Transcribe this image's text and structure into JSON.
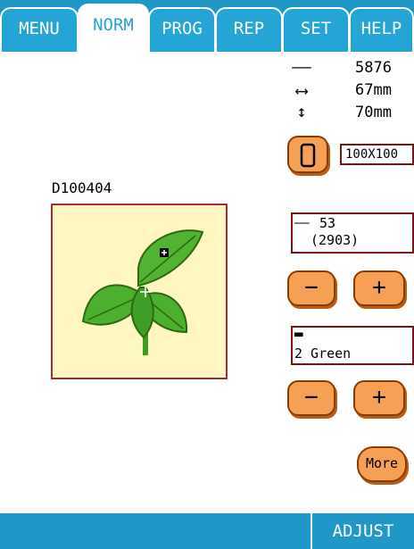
{
  "tabs": [
    {
      "label": "MENU"
    },
    {
      "label": "NORM"
    },
    {
      "label": "PROG"
    },
    {
      "label": "REP"
    },
    {
      "label": "SET"
    },
    {
      "label": "HELP"
    }
  ],
  "design_info": {
    "stitch_count": "5876",
    "width": "67mm",
    "height": "70mm"
  },
  "hoop": {
    "size": "100X100"
  },
  "design": {
    "name": "D100404"
  },
  "stitch_position": {
    "current": "53",
    "total": "(2903)"
  },
  "color": {
    "label": "2 Green"
  },
  "buttons": {
    "minus": "−",
    "plus": "+",
    "more": "More",
    "adjust": "ADJUST"
  },
  "icons": {
    "stitch": "––",
    "width": "⟷",
    "height": "↕",
    "spool": "▬"
  },
  "colors": {
    "blue_bar": "#1f98c8",
    "tab_blue": "#25a4d6",
    "button_orange": "#f6a055",
    "design_bg": "#fff6c2",
    "leaf_green": "#4caf2e"
  }
}
